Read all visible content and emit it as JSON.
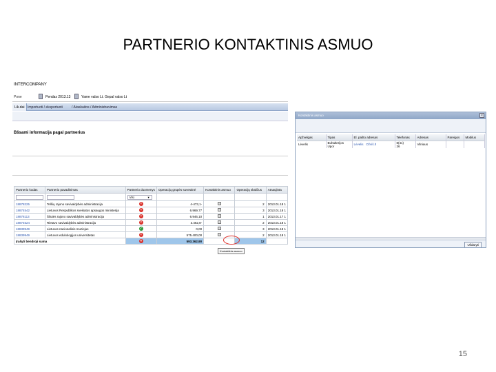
{
  "slide": {
    "title": "PARTNERIO KONTAKTINIS ASMUO",
    "page_number": "15"
  },
  "app": {
    "title": "INTERCOMPANY",
    "home_label": "Pone",
    "doc_label_1": "Pendas 2013.13",
    "doc_label_2": "Yame valso Lt. Gepal valso Lt",
    "menu": {
      "active": "Lik.dai",
      "item_1": "Importuoti / eksportuoti",
      "item_2": "/ Ataskaitos / Administravimas"
    },
    "section_heading": "Bšsami informacija pagal partnerius",
    "grid": {
      "columns": [
        "Partnerio kodas",
        "Partnerio pavadinimas",
        "Partnerio duomenys",
        "Operacijų grupės suvestinė",
        "Kontaktinis asmuo",
        "Operacijų skaičius",
        "Atnaujinta"
      ],
      "filter_select": "Visi",
      "rows": [
        {
          "code": "18878225",
          "name": "Telšių rajono savivaldybės administracija",
          "status": "x",
          "amount": "4-473,1-",
          "count": "2",
          "date": "2013.01.18 1"
        },
        {
          "code": "18874542",
          "name": "Lietuvos Respublikos sveikatos apsaugos ministerija",
          "status": "x",
          "amount": "6.969,77",
          "count": "3",
          "date": "2013.01.18 1"
        },
        {
          "code": "18878113",
          "name": "Šilutės rajono savivaldybės administracija",
          "status": "x",
          "amount": "6.946,10",
          "count": "1",
          "date": "2013.01.17 1"
        },
        {
          "code": "18874524",
          "name": "Rietavo savivaldybės administracija",
          "status": "x",
          "amount": "3.462,8-",
          "count": "2",
          "date": "2013.01.18 1"
        },
        {
          "code": "18839949",
          "name": "Lietuvos nacionalinis muziejus",
          "status": "ok",
          "amount": "0,00",
          "count": "3",
          "date": "2013.01.18 1"
        },
        {
          "code": "18839949",
          "name": "Lietuvos edukologijos universitetas",
          "status": "x",
          "amount": "575.400,00",
          "count": "2",
          "date": "2013.01.18 1"
        }
      ],
      "sum_label": "Įrašyti bendroji suma",
      "sum_amount": "593.362,90",
      "sum_count": "12"
    },
    "tooltip": "Kontaktinis asmuo"
  },
  "popup": {
    "title": "Kontaktinis asmuo",
    "columns": [
      "Apžvelgas",
      "Tipas",
      "El. pašto adresas",
      "Telefonas",
      "Adresas",
      "Pareigos",
      "Mobilus"
    ],
    "row": {
      "name": "Lėvelis",
      "type_line1": "Buhalterijos",
      "type_line2": "Upor",
      "email": "Lėvelis",
      "email_link": "Ožviš.lt",
      "phone_line1": "8(41)",
      "phone_line2": "26",
      "address": "Vilniaus"
    },
    "close_label": "Uždaryti"
  }
}
